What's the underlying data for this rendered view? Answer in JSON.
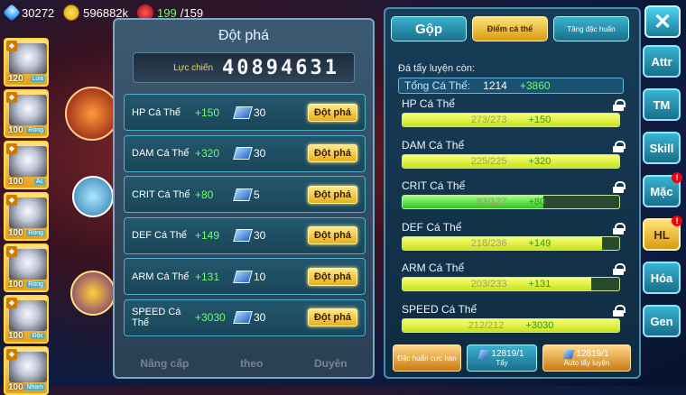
{
  "resources": {
    "gems": "30272",
    "gold": "596882k",
    "potion": "199",
    "potion_max": "/159"
  },
  "pets": [
    {
      "level": "120",
      "type": "Lửa"
    },
    {
      "level": "100",
      "type": "Rồng"
    },
    {
      "level": "100",
      "type": "Ác"
    },
    {
      "level": "100",
      "type": "Rồng"
    },
    {
      "level": "100",
      "type": "Rồng"
    },
    {
      "level": "100",
      "type": "Độc"
    },
    {
      "level": "100",
      "type": "Nham"
    }
  ],
  "breakthrough": {
    "title": "Đột phá",
    "power_label": "Lực chiến",
    "power_value": "40894631",
    "button_label": "Đột phá",
    "rows": [
      {
        "name": "HP Cá Thể",
        "increase": "+150",
        "cost": "30"
      },
      {
        "name": "DAM Cá Thể",
        "increase": "+320",
        "cost": "30"
      },
      {
        "name": "CRIT Cá Thể",
        "increase": "+80",
        "cost": "5"
      },
      {
        "name": "DEF Cá Thể",
        "increase": "+149",
        "cost": "30"
      },
      {
        "name": "ARM Cá Thể",
        "increase": "+131",
        "cost": "10"
      },
      {
        "name": "SPEED Cá Thể",
        "increase": "+3030",
        "cost": "30"
      }
    ],
    "bottom_labels": [
      "Nâng cấp",
      "theo",
      "Duyên"
    ]
  },
  "right_panel": {
    "tabs": [
      "Gộp",
      "Điểm cá thể",
      "Tăng đặc huấn"
    ],
    "remain_label": "Đá tẩy luyện còn:",
    "total_label": "Tổng Cá Thể:",
    "total_value": "1214",
    "total_plus": "+3860",
    "stats": [
      {
        "name": "HP Cá Thể",
        "value": "273/273",
        "inc": "+150",
        "fill": 1.0,
        "color": "yellow"
      },
      {
        "name": "DAM Cá Thể",
        "value": "225/225",
        "inc": "+320",
        "fill": 1.0,
        "color": "yellow"
      },
      {
        "name": "CRIT Cá Thể",
        "value": "83/127",
        "inc": "+80",
        "fill": 0.65,
        "color": "green"
      },
      {
        "name": "DEF Cá Thể",
        "value": "218/236",
        "inc": "+149",
        "fill": 0.92,
        "color": "yellow"
      },
      {
        "name": "ARM Cá Thể",
        "value": "203/233",
        "inc": "+131",
        "fill": 0.87,
        "color": "yellow"
      },
      {
        "name": "SPEED Cá Thể",
        "value": "212/212",
        "inc": "+3030",
        "fill": 1.0,
        "color": "yellow"
      }
    ],
    "bottom": {
      "dac_huan": "Đặc huấn cực hạn",
      "tay_count": "12819/1",
      "tay_label": "Tẩy",
      "auto_count": "12819/1",
      "auto_label": "Auto tẩy luyện"
    }
  },
  "sidebar": [
    "Attr",
    "TM",
    "Skill",
    "Mặc",
    "HL",
    "Hóa",
    "Gen"
  ],
  "badge": "!"
}
